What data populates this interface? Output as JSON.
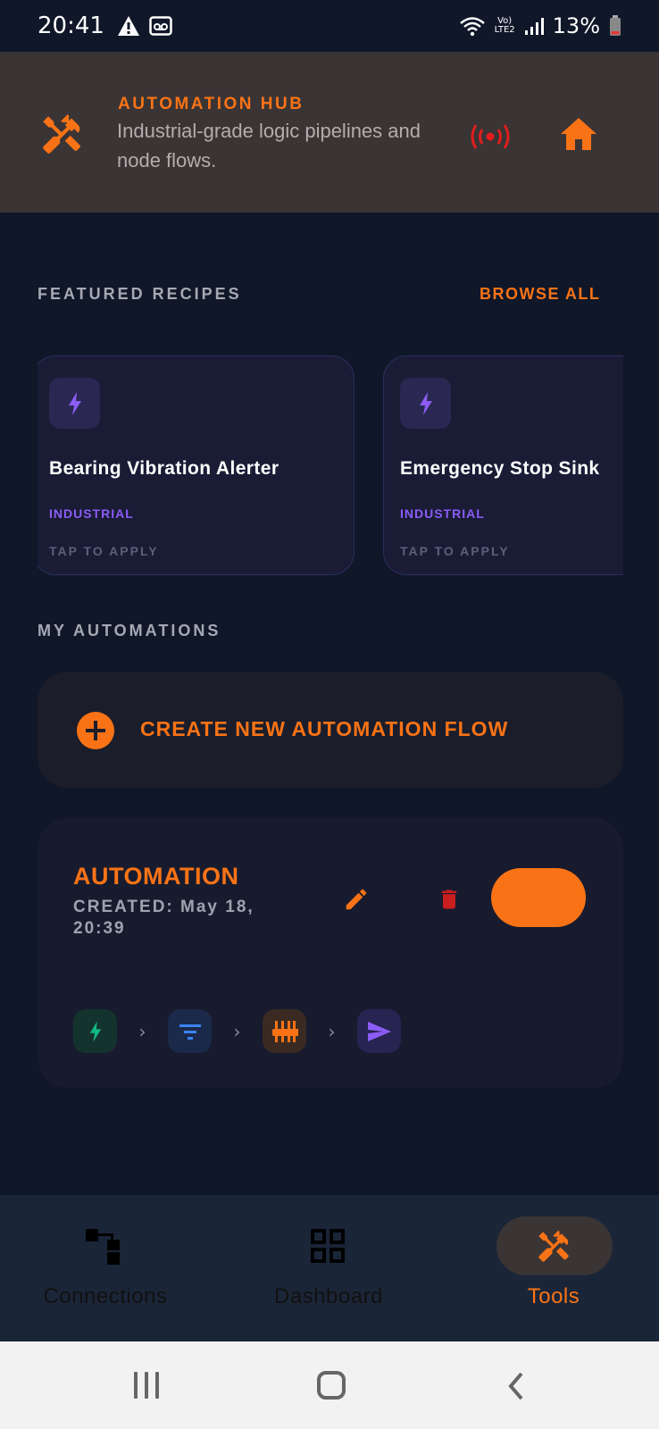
{
  "status_bar": {
    "time": "20:41",
    "battery": "13%",
    "network_top": "Vo)",
    "network_bottom": "LTE2",
    "icons": [
      "warning-icon",
      "voicemail-icon",
      "wifi-icon",
      "signal-icon",
      "battery-icon"
    ]
  },
  "header": {
    "title": "AUTOMATION HUB",
    "subtitle": "Industrial-grade logic pipelines and node flows.",
    "icons": [
      "tools-icon",
      "broadcast-icon",
      "home-icon"
    ]
  },
  "featured": {
    "label": "FEATURED RECIPES",
    "browse_all": "BROWSE ALL",
    "recipes": [
      {
        "title": "Bearing Vibration Alerter",
        "tag": "INDUSTRIAL",
        "cta": "TAP TO APPLY",
        "icon": "bolt-icon"
      },
      {
        "title": "Emergency Stop Sink",
        "tag": "INDUSTRIAL",
        "cta": "TAP TO APPLY",
        "icon": "bolt-icon"
      }
    ]
  },
  "my_automations": {
    "label": "MY AUTOMATIONS",
    "create_label": "CREATE NEW AUTOMATION FLOW",
    "items": [
      {
        "name": "AUTOMATION",
        "created": "CREATED: May 18, 20:39",
        "enabled": true,
        "pipeline": [
          "bolt-icon",
          "filter-icon",
          "tune-icon",
          "send-icon"
        ]
      }
    ]
  },
  "bottom_nav": {
    "items": [
      {
        "label": "Connections",
        "icon": "connections-icon"
      },
      {
        "label": "Dashboard",
        "icon": "dashboard-icon"
      },
      {
        "label": "Tools",
        "icon": "tools-icon",
        "active": true
      }
    ]
  },
  "colors": {
    "accent": "#f97316",
    "background": "#0f1729",
    "header_bg": "#3a3435",
    "card_bg": "#181b2e",
    "recipe_accent": "#8b5cf6",
    "danger": "#dc2626"
  }
}
